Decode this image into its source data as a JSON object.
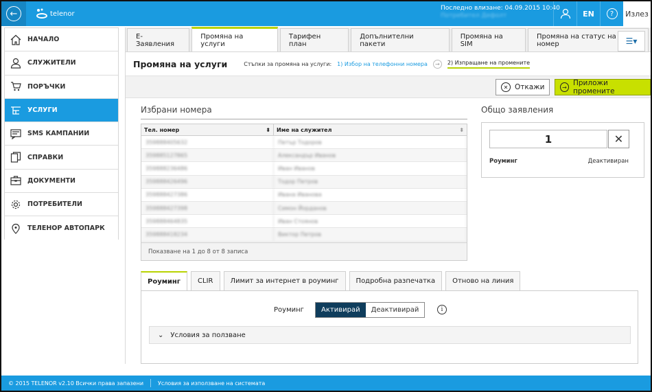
{
  "app": {
    "logo_text": "telenor",
    "last_login": "Последно влизане: 04.09.2015 10:40",
    "user_name": "Потребител Дефолт",
    "lang": "EN",
    "exit_label": "Излез"
  },
  "sidebar": {
    "items": [
      {
        "label": "НАЧАЛО",
        "icon": "home-icon"
      },
      {
        "label": "СЛУЖИТЕЛИ",
        "icon": "user-icon"
      },
      {
        "label": "ПОРЪЧКИ",
        "icon": "cart-icon"
      },
      {
        "label": "УСЛУГИ",
        "icon": "services-icon"
      },
      {
        "label": "SMS КАМПАНИИ",
        "icon": "sms-icon"
      },
      {
        "label": "СПРАВКИ",
        "icon": "reports-icon"
      },
      {
        "label": "ДОКУМЕНТИ",
        "icon": "briefcase-icon"
      },
      {
        "label": "ПОТРЕБИТЕЛИ",
        "icon": "gear-icon"
      },
      {
        "label": "ТЕЛЕНОР АВТОПАРК",
        "icon": "location-pin-icon"
      }
    ]
  },
  "tabs": [
    "Е-Заявления",
    "Промяна на услуги",
    "Тарифен план",
    "Допълнителни пакети",
    "Промяна на SIM",
    "Промяна на статус на номер"
  ],
  "page": {
    "title": "Промяна на услуги",
    "steps_label": "Стъпки за промяна на услуги:",
    "step1": "1) Избор на телефонни номера",
    "step2": "2) Изпращане на промените"
  },
  "actions": {
    "cancel": "Откажи",
    "apply": "Приложи промените"
  },
  "selected": {
    "title": "Избрани номера",
    "col_phone": "Тел. номер",
    "col_name": "Име на служител",
    "rows": [
      [
        "359888405632",
        "Петър Тодоров"
      ],
      [
        "359885127865",
        "Александър Иванов"
      ],
      [
        "359888236486",
        "Иван Иванов"
      ],
      [
        "359888426496",
        "Тодор Петров"
      ],
      [
        "359888427386",
        "Ивана Иванова"
      ],
      [
        "359888427398",
        "Симон Йорданов"
      ],
      [
        "359888464835",
        "Иван Стоянов"
      ],
      [
        "359888418234",
        "Виктор Петров"
      ]
    ],
    "footer": "Показване на 1 до 8 от 8 записа"
  },
  "summary": {
    "title": "Общо заявления",
    "count": "1",
    "label": "Роуминг",
    "status": "Деактивиран"
  },
  "bottom_tabs": [
    "Роуминг",
    "CLIR",
    "Лимит за интернет в роуминг",
    "Подробна разпечатка",
    "Отново на линия"
  ],
  "roaming": {
    "label": "Роуминг",
    "on": "Активирай",
    "off": "Деактивирай",
    "terms": "Условия за ползване"
  },
  "footer": {
    "copyright": "© 2015 TELENOR v2.10 Всички права запазени",
    "terms": "Условия за използване на системата"
  }
}
